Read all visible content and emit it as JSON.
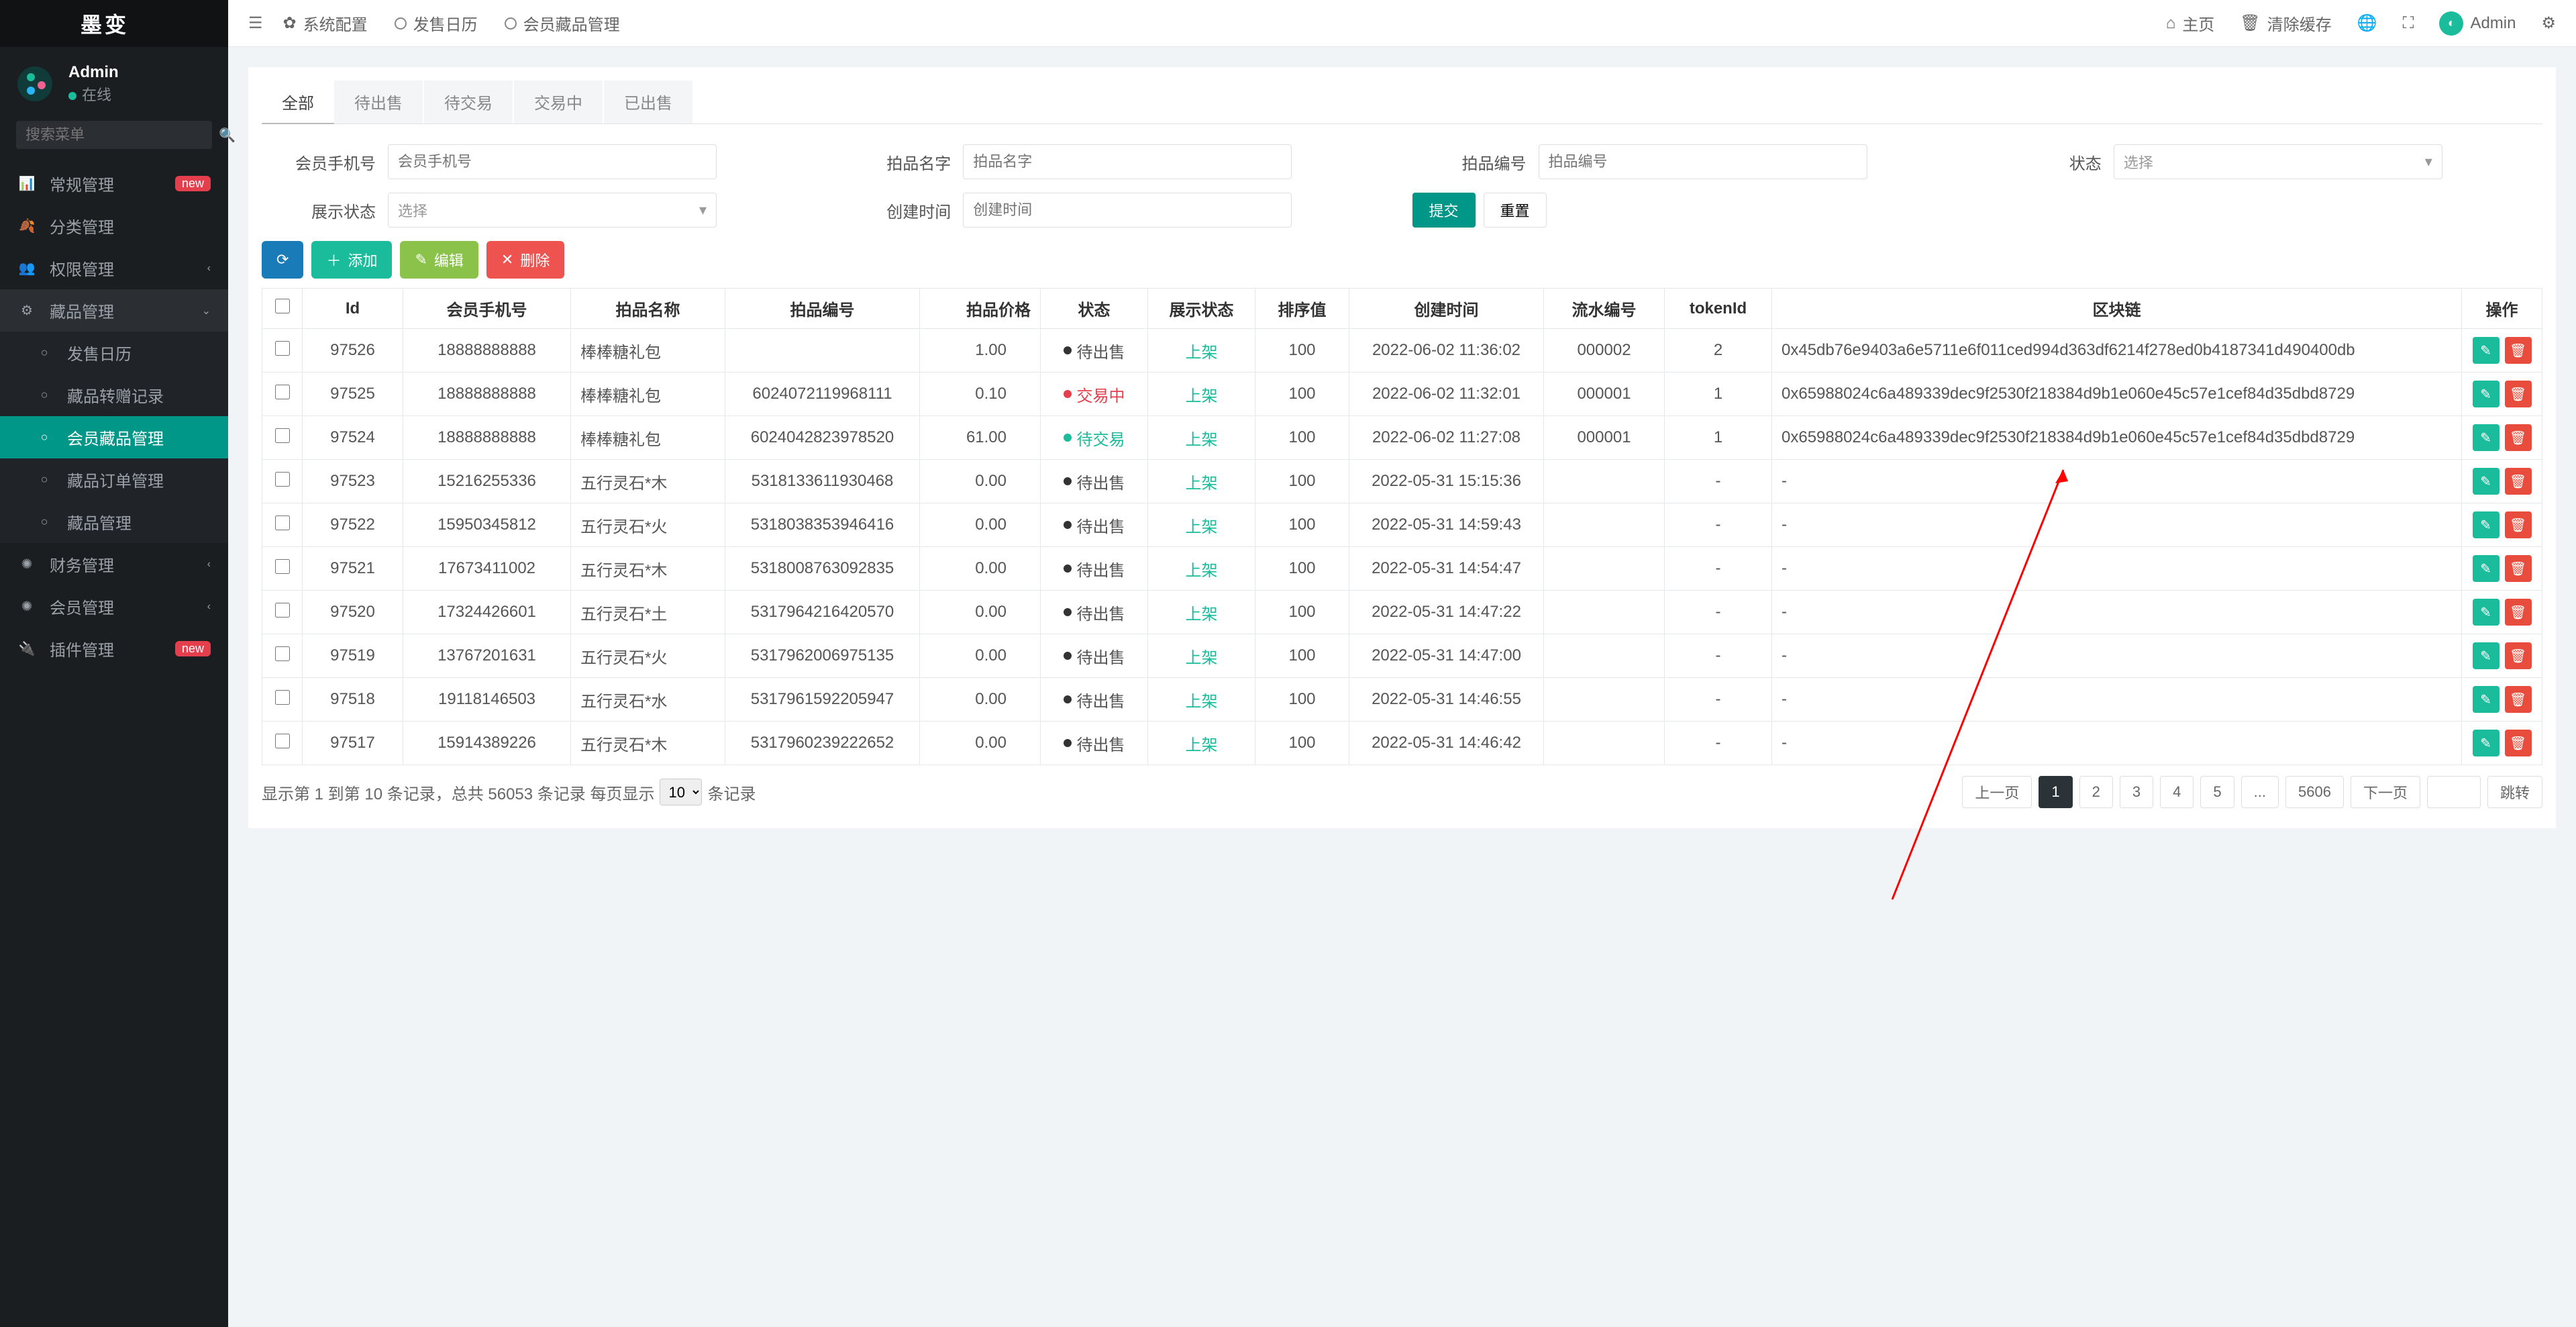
{
  "brand": "墨变",
  "user": {
    "name": "Admin",
    "status": "在线"
  },
  "sidebar": {
    "search_placeholder": "搜索菜单",
    "items": [
      {
        "label": "常规管理",
        "icon": "📊",
        "badge": "new"
      },
      {
        "label": "分类管理",
        "icon": "🍂"
      },
      {
        "label": "权限管理",
        "icon": "👥",
        "caret": true
      },
      {
        "label": "藏品管理",
        "icon": "⚙",
        "caret_open": true,
        "children": [
          {
            "label": "发售日历",
            "icon": "○"
          },
          {
            "label": "藏品转赠记录",
            "icon": "○"
          },
          {
            "label": "会员藏品管理",
            "icon": "○",
            "active": true
          },
          {
            "label": "藏品订单管理",
            "icon": "○"
          },
          {
            "label": "藏品管理",
            "icon": "○"
          }
        ]
      },
      {
        "label": "财务管理",
        "icon": "✺",
        "caret": true
      },
      {
        "label": "会员管理",
        "icon": "✺",
        "caret": true
      },
      {
        "label": "插件管理",
        "icon": "🔌",
        "badge": "new"
      }
    ]
  },
  "topbar": {
    "crumbs": [
      "系统配置",
      "发售日历",
      "会员藏品管理"
    ],
    "home": "主页",
    "clear_cache": "清除缓存",
    "user": "Admin"
  },
  "tabs": [
    "全部",
    "待出售",
    "待交易",
    "交易中",
    "已出售"
  ],
  "filters": {
    "phone_label": "会员手机号",
    "phone_ph": "会员手机号",
    "pname_label": "拍品名字",
    "pname_ph": "拍品名字",
    "pno_label": "拍品编号",
    "pno_ph": "拍品编号",
    "status_label": "状态",
    "status_ph": "选择",
    "show_label": "展示状态",
    "show_ph": "选择",
    "ctime_label": "创建时间",
    "ctime_ph": "创建时间",
    "submit": "提交",
    "reset": "重置"
  },
  "toolbar": {
    "refresh": "⟳",
    "add": "添加",
    "edit": "编辑",
    "delete": "删除"
  },
  "columns": {
    "id": "Id",
    "phone": "会员手机号",
    "pname": "拍品名称",
    "pno": "拍品编号",
    "price": "拍品价格",
    "status": "状态",
    "show": "展示状态",
    "sort": "排序值",
    "ctime": "创建时间",
    "serial": "流水编号",
    "token": "tokenId",
    "chain": "区块链",
    "ops": "操作"
  },
  "rows": [
    {
      "id": "97526",
      "phone": "18888888888",
      "pname": "棒棒糖礼包",
      "pno": "",
      "price": "1.00",
      "status": "待出售",
      "scls": "",
      "show": "上架",
      "sort": "100",
      "ctime": "2022-06-02 11:36:02",
      "serial": "000002",
      "token": "2",
      "chain": "0x45db76e9403a6e5711e6f011ced994d363df6214f278ed0b4187341d490400db"
    },
    {
      "id": "97525",
      "phone": "18888888888",
      "pname": "棒棒糖礼包",
      "pno": "6024072119968111",
      "price": "0.10",
      "status": "交易中",
      "scls": "red",
      "show": "上架",
      "sort": "100",
      "ctime": "2022-06-02 11:32:01",
      "serial": "000001",
      "token": "1",
      "chain": "0x65988024c6a489339dec9f2530f218384d9b1e060e45c57e1cef84d35dbd8729"
    },
    {
      "id": "97524",
      "phone": "18888888888",
      "pname": "棒棒糖礼包",
      "pno": "6024042823978520",
      "price": "61.00",
      "status": "待交易",
      "scls": "green",
      "show": "上架",
      "sort": "100",
      "ctime": "2022-06-02 11:27:08",
      "serial": "000001",
      "token": "1",
      "chain": "0x65988024c6a489339dec9f2530f218384d9b1e060e45c57e1cef84d35dbd8729"
    },
    {
      "id": "97523",
      "phone": "15216255336",
      "pname": "五行灵石*木",
      "pno": "5318133611930468",
      "price": "0.00",
      "status": "待出售",
      "scls": "",
      "show": "上架",
      "sort": "100",
      "ctime": "2022-05-31 15:15:36",
      "serial": "",
      "token": "-",
      "chain": "-"
    },
    {
      "id": "97522",
      "phone": "15950345812",
      "pname": "五行灵石*火",
      "pno": "5318038353946416",
      "price": "0.00",
      "status": "待出售",
      "scls": "",
      "show": "上架",
      "sort": "100",
      "ctime": "2022-05-31 14:59:43",
      "serial": "",
      "token": "-",
      "chain": "-"
    },
    {
      "id": "97521",
      "phone": "17673411002",
      "pname": "五行灵石*木",
      "pno": "5318008763092835",
      "price": "0.00",
      "status": "待出售",
      "scls": "",
      "show": "上架",
      "sort": "100",
      "ctime": "2022-05-31 14:54:47",
      "serial": "",
      "token": "-",
      "chain": "-"
    },
    {
      "id": "97520",
      "phone": "17324426601",
      "pname": "五行灵石*土",
      "pno": "5317964216420570",
      "price": "0.00",
      "status": "待出售",
      "scls": "",
      "show": "上架",
      "sort": "100",
      "ctime": "2022-05-31 14:47:22",
      "serial": "",
      "token": "-",
      "chain": "-"
    },
    {
      "id": "97519",
      "phone": "13767201631",
      "pname": "五行灵石*火",
      "pno": "5317962006975135",
      "price": "0.00",
      "status": "待出售",
      "scls": "",
      "show": "上架",
      "sort": "100",
      "ctime": "2022-05-31 14:47:00",
      "serial": "",
      "token": "-",
      "chain": "-"
    },
    {
      "id": "97518",
      "phone": "19118146503",
      "pname": "五行灵石*水",
      "pno": "5317961592205947",
      "price": "0.00",
      "status": "待出售",
      "scls": "",
      "show": "上架",
      "sort": "100",
      "ctime": "2022-05-31 14:46:55",
      "serial": "",
      "token": "-",
      "chain": "-"
    },
    {
      "id": "97517",
      "phone": "15914389226",
      "pname": "五行灵石*木",
      "pno": "5317960239222652",
      "price": "0.00",
      "status": "待出售",
      "scls": "",
      "show": "上架",
      "sort": "100",
      "ctime": "2022-05-31 14:46:42",
      "serial": "",
      "token": "-",
      "chain": "-"
    }
  ],
  "footer": {
    "summary_a": "显示第 1 到第 10 条记录，总共 56053 条记录  每页显示",
    "summary_b": "条记录",
    "per_page": "10",
    "prev": "上一页",
    "next": "下一页",
    "pages": [
      "1",
      "2",
      "3",
      "4",
      "5",
      "...",
      "5606"
    ],
    "jump": "跳转"
  }
}
